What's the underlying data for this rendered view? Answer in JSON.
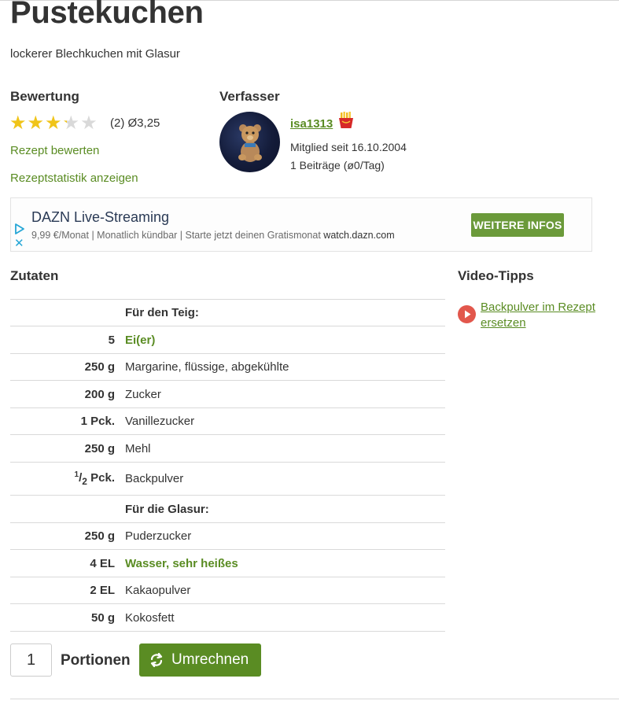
{
  "recipe": {
    "title": "Pustekuchen",
    "subtitle": "lockerer Blechkuchen mit Glasur"
  },
  "rating": {
    "heading": "Bewertung",
    "stars_value": 3.25,
    "stars_max": 5,
    "count_text": "(2)",
    "average_text": "Ø3,25",
    "rate_link": "Rezept bewerten",
    "stats_link": "Rezeptstatistik anzeigen"
  },
  "author": {
    "heading": "Verfasser",
    "name": "isa1313",
    "member_since": "Mitglied seit 16.10.2004",
    "posts": "1 Beiträge (ø0/Tag)",
    "badge_icon": "fries-icon"
  },
  "ad": {
    "title": "DAZN Live-Streaming",
    "description": "9,99 €/Monat | Monatlich kündbar | Starte jetzt deinen Gratismonat",
    "domain": "watch.dazn.com",
    "button_label": "WEITERE INFOS",
    "close_glyph": "✕"
  },
  "ingredients": {
    "heading": "Zutaten",
    "rows": [
      {
        "amount": "",
        "name": "Für den Teig:",
        "kind": "header"
      },
      {
        "amount": "5",
        "name": "Ei(er)",
        "kind": "link"
      },
      {
        "amount": "250 g",
        "name": "Margarine, flüssige, abgekühlte",
        "kind": "plain"
      },
      {
        "amount": "200 g",
        "name": "Zucker",
        "kind": "plain"
      },
      {
        "amount": "1 Pck.",
        "name": "Vanillezucker",
        "kind": "plain"
      },
      {
        "amount": "250 g",
        "name": "Mehl",
        "kind": "plain"
      },
      {
        "amount": "1/2 Pck.",
        "name": "Backpulver",
        "kind": "fraction"
      },
      {
        "amount": "",
        "name": "Für die Glasur:",
        "kind": "header"
      },
      {
        "amount": "250 g",
        "name": "Puderzucker",
        "kind": "plain"
      },
      {
        "amount": "4 EL",
        "name": "Wasser, sehr heißes",
        "kind": "link"
      },
      {
        "amount": "2 EL",
        "name": "Kakaopulver",
        "kind": "plain"
      },
      {
        "amount": "50 g",
        "name": "Kokosfett",
        "kind": "plain"
      }
    ],
    "fraction": {
      "num": "1",
      "den": "2",
      "unit": "Pck."
    }
  },
  "video": {
    "heading": "Video-Tipps",
    "link": "Backpulver im Rezept ersetzen"
  },
  "portions": {
    "value": "1",
    "label": "Portionen",
    "button_label": "Umrechnen"
  },
  "colors": {
    "accent_green": "#5a8c23",
    "star_filled": "#f0c419",
    "star_empty": "#d9d9d9",
    "play_red": "#e2574c"
  }
}
